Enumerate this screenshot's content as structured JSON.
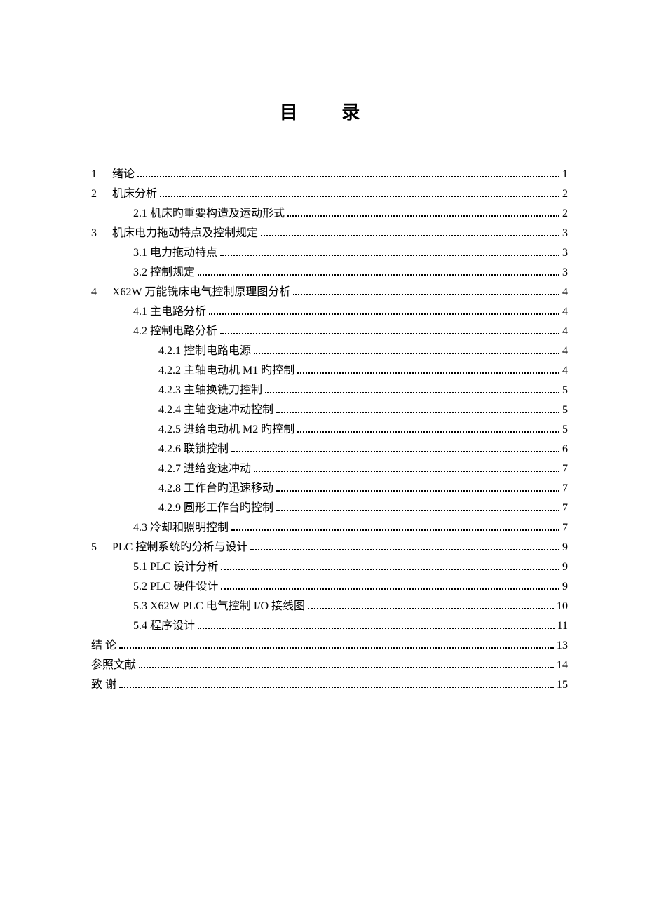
{
  "title": "目 录",
  "toc": [
    {
      "num": "1",
      "label": "绪论",
      "page": "1",
      "indent": 0
    },
    {
      "num": "2",
      "label": "机床分析",
      "page": "2",
      "indent": 0
    },
    {
      "num": "",
      "label": "2.1 机床旳重要构造及运动形式",
      "page": "2",
      "indent": 1
    },
    {
      "num": "3",
      "label": "机床电力拖动特点及控制规定",
      "page": "3",
      "indent": 0
    },
    {
      "num": "",
      "label": "3.1 电力拖动特点",
      "page": "3",
      "indent": 1
    },
    {
      "num": "",
      "label": "3.2 控制规定",
      "page": "3",
      "indent": 1
    },
    {
      "num": "4",
      "label": "X62W 万能铣床电气控制原理图分析",
      "page": "4",
      "indent": 0
    },
    {
      "num": "",
      "label": "4.1 主电路分析",
      "page": "4",
      "indent": 1
    },
    {
      "num": "",
      "label": "4.2 控制电路分析",
      "page": "4",
      "indent": 1
    },
    {
      "num": "",
      "label": "4.2.1 控制电路电源",
      "page": "4",
      "indent": 2
    },
    {
      "num": "",
      "label": "4.2.2 主轴电动机 M1 旳控制",
      "page": "4",
      "indent": 2
    },
    {
      "num": "",
      "label": "4.2.3 主轴换铣刀控制",
      "page": "5",
      "indent": 2
    },
    {
      "num": "",
      "label": "4.2.4 主轴变速冲动控制",
      "page": "5",
      "indent": 2
    },
    {
      "num": "",
      "label": "4.2.5 进给电动机 M2 旳控制",
      "page": "5",
      "indent": 2
    },
    {
      "num": "",
      "label": "4.2.6 联锁控制",
      "page": "6",
      "indent": 2
    },
    {
      "num": "",
      "label": "4.2.7 进给变速冲动",
      "page": "7",
      "indent": 2
    },
    {
      "num": "",
      "label": "4.2.8 工作台旳迅速移动",
      "page": "7",
      "indent": 2
    },
    {
      "num": "",
      "label": "4.2.9 圆形工作台旳控制",
      "page": "7",
      "indent": 2
    },
    {
      "num": "",
      "label": "4.3 冷却和照明控制",
      "page": "7",
      "indent": 1
    },
    {
      "num": "5",
      "label": "PLC 控制系统旳分析与设计",
      "page": "9",
      "indent": 0
    },
    {
      "num": "",
      "label": "5.1 PLC 设计分析",
      "page": "9",
      "indent": 1
    },
    {
      "num": "",
      "label": "5.2 PLC 硬件设计",
      "page": "9",
      "indent": 1
    },
    {
      "num": "",
      "label": "5.3 X62W PLC 电气控制 I/O 接线图",
      "page": "10",
      "indent": 1
    },
    {
      "num": "",
      "label": "5.4 程序设计",
      "page": "11",
      "indent": 1
    },
    {
      "num": "",
      "label": "结 论",
      "page": "13",
      "indent": -1
    },
    {
      "num": "",
      "label": "参照文献",
      "page": "14",
      "indent": -1
    },
    {
      "num": "",
      "label": "致 谢",
      "page": "15",
      "indent": -1
    }
  ]
}
